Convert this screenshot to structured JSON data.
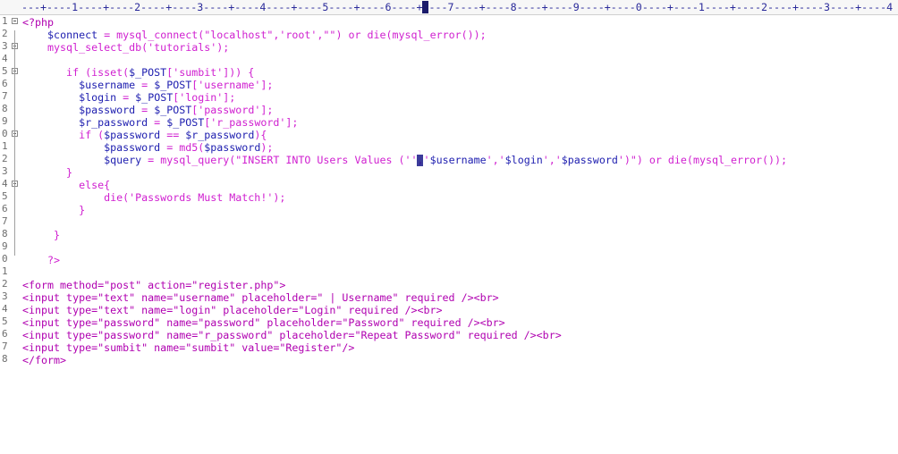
{
  "editor": {
    "ruler": "---+----1----+----2----+----3----+----4----+----5----+----6----+----7----+----8----+----9----+----0----+----1----+----2----+----3----+----4",
    "line_numbers": [
      "1",
      "2",
      "3",
      "4",
      "5",
      "6",
      "7",
      "8",
      "9",
      "0",
      "1",
      "2",
      "3",
      "4",
      "5",
      "6",
      "7",
      "8",
      "9",
      "0",
      "1",
      "2",
      "3",
      "4",
      "5",
      "6",
      "7",
      "8"
    ],
    "lines": [
      "<?php",
      "    $connect = mysql_connect(\"localhost\",'root',\"\") or die(mysql_error());",
      "    mysql_select_db('tutorials');",
      "",
      "       if (isset($_POST['sumbit'])) {",
      "         $username = $_POST['username'];",
      "         $login = $_POST['login'];",
      "         $password = $_POST['password'];",
      "         $r_password = $_POST['r_password'];",
      "         if ($password == $r_password){",
      "             $password = md5($password);",
      "             $query = mysql_query(\"INSERT INTO Users Values ('','$username','$login','$password')\") or die(mysql_error());",
      "       }",
      "         else{",
      "             die('Passwords Must Match!');",
      "         }",
      "",
      "     }",
      "",
      "    ?>",
      "",
      "<form method=\"post\" action=\"register.php\">",
      "<input type=\"text\" name=\"username\" placeholder=\" | Username\" required /><br>",
      "<input type=\"text\" name=\"login\" placeholder=\"Login\" required /><br>",
      "<input type=\"password\" name=\"password\" placeholder=\"Password\" required /><br>",
      "<input type=\"password\" name=\"r_password\" placeholder=\"Repeat Password\" required /><br>",
      "<input type=\"sumbit\" name=\"sumbit\" value=\"Register\"/>",
      "</form>"
    ],
    "fold_lines": [
      1,
      3,
      5,
      10,
      14
    ],
    "colors": {
      "html": "#b000b0",
      "php_keyword": "#d020d0",
      "variable": "#2020b0",
      "plain": "#2a2a2a"
    }
  }
}
